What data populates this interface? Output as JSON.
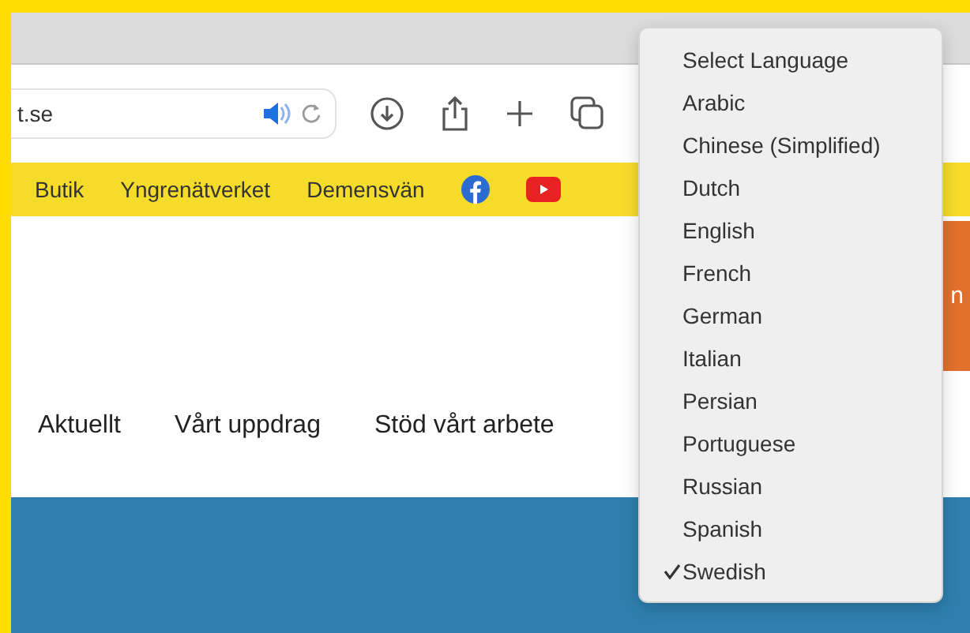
{
  "browser": {
    "url": "t.se"
  },
  "top_links": [
    {
      "label": "Butik"
    },
    {
      "label": "Yngrenätverket"
    },
    {
      "label": "Demensvän"
    }
  ],
  "main_nav": [
    {
      "label": "Aktuellt"
    },
    {
      "label": "Vårt uppdrag"
    },
    {
      "label": "Stöd vårt arbete"
    }
  ],
  "orange_button": {
    "label": "n"
  },
  "language_menu": {
    "items": [
      {
        "label": "Select Language",
        "checked": false
      },
      {
        "label": "Arabic",
        "checked": false
      },
      {
        "label": "Chinese (Simplified)",
        "checked": false
      },
      {
        "label": "Dutch",
        "checked": false
      },
      {
        "label": "English",
        "checked": false
      },
      {
        "label": "French",
        "checked": false
      },
      {
        "label": "German",
        "checked": false
      },
      {
        "label": "Italian",
        "checked": false
      },
      {
        "label": "Persian",
        "checked": false
      },
      {
        "label": "Portuguese",
        "checked": false
      },
      {
        "label": "Russian",
        "checked": false
      },
      {
        "label": "Spanish",
        "checked": false
      },
      {
        "label": "Swedish",
        "checked": true
      }
    ]
  }
}
